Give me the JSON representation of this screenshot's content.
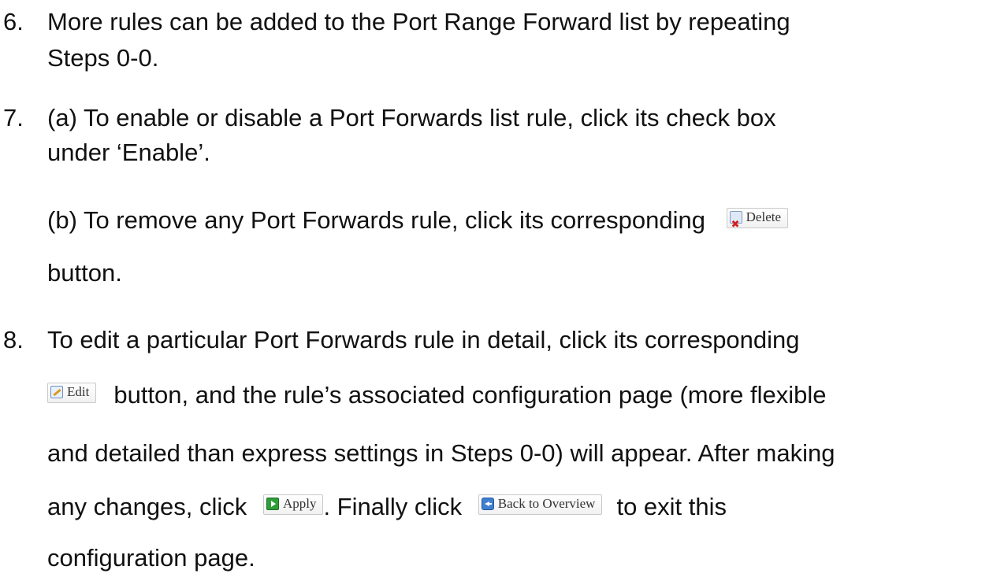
{
  "steps": {
    "s6": {
      "num": "6.",
      "l1": "More rules can be added to the Port Range Forward list by repeating",
      "l2": "Steps 0-0."
    },
    "s7": {
      "num": "7.",
      "l1": "(a) To enable or disable a Port Forwards list rule, click its check box",
      "l2": "under ‘Enable’.",
      "b_text": "(b) To remove any Port Forwards rule, click its corresponding",
      "b_after": "button."
    },
    "s8": {
      "num": "8.",
      "l1": "To edit a particular Port Forwards rule in detail, click its corresponding",
      "edit_after": "button, and the rule’s associated configuration page (more flexible",
      "l3": "and detailed than express settings in Steps 0-0) will appear. After making",
      "apply_before": "any changes, click",
      "apply_after": ". Finally click",
      "back_after": "to exit this",
      "l5": "configuration page."
    }
  },
  "buttons": {
    "delete": {
      "label": "Delete",
      "icon": "delete-x-icon"
    },
    "edit": {
      "label": "Edit",
      "icon": "edit-pencil-icon"
    },
    "apply": {
      "label": "Apply",
      "icon": "apply-play-icon"
    },
    "back": {
      "label": "Back to Overview",
      "icon": "back-arrow-icon"
    }
  }
}
